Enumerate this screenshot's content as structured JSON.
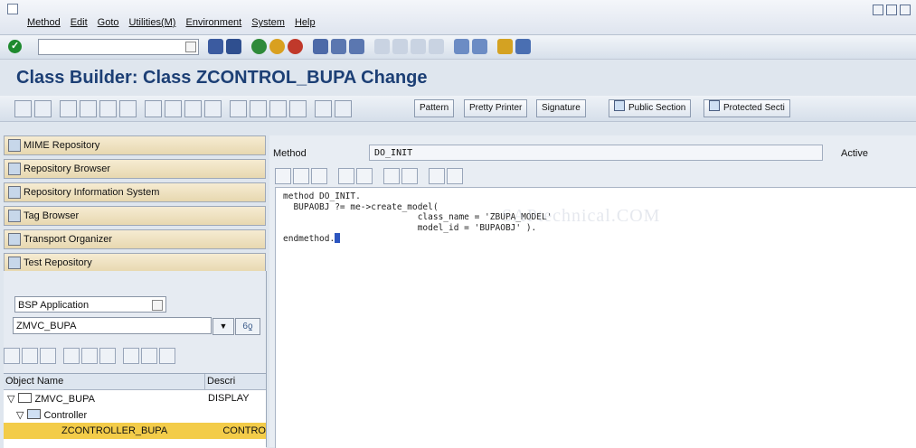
{
  "menubar": {
    "items": [
      "Method",
      "Edit",
      "Goto",
      "Utilities(M)",
      "Environment",
      "System",
      "Help"
    ]
  },
  "title": "Class Builder: Class ZCONTROL_BUPA Change",
  "app_toolbar": {
    "buttons": [
      "Pattern",
      "Pretty Printer",
      "Signature",
      "Public Section",
      "Protected Secti"
    ]
  },
  "navigation": {
    "buttons": [
      "MIME Repository",
      "Repository Browser",
      "Repository Information System",
      "Tag Browser",
      "Transport Organizer",
      "Test Repository"
    ]
  },
  "object_panel": {
    "type_select": "BSP Application",
    "object_input": "ZMVC_BUPA",
    "columns": [
      "Object Name",
      "Descri"
    ],
    "rows": [
      {
        "name": "ZMVC_BUPA",
        "desc": "DISPLAY"
      },
      {
        "name": "Controller",
        "desc": ""
      },
      {
        "name": "ZCONTROLLER_BUPA",
        "desc": "CONTRO"
      }
    ]
  },
  "method_panel": {
    "label": "Method",
    "value": "DO_INIT",
    "status": "Active"
  },
  "code": {
    "lines": [
      "method DO_INIT.",
      "",
      "  BUPAOBJ ?= me->create_model(",
      "                          class_name = 'ZBUPA_MODEL'",
      "                          model_id = 'BUPAOBJ' ).",
      "",
      "endmethod."
    ],
    "watermark": "SAPtechnical.COM"
  },
  "colors": {
    "title": "#1c3f75",
    "selection": "#f3cc49",
    "nav_button": "#e7d8b0"
  }
}
